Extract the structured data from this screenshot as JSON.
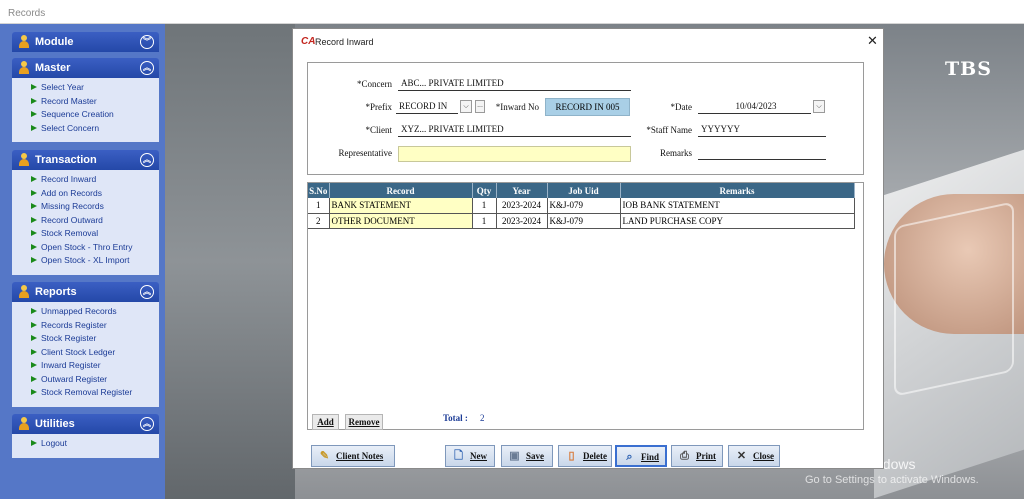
{
  "window": {
    "title": "Records"
  },
  "sidebar": {
    "module": {
      "title": "Module",
      "items": []
    },
    "master": {
      "title": "Master",
      "items": [
        "Select Year",
        "Record Master",
        "Sequence Creation",
        "Select Concern"
      ]
    },
    "transaction": {
      "title": "Transaction",
      "items": [
        "Record Inward",
        "Add on Records",
        "Missing Records",
        "Record Outward",
        "Stock Removal",
        "Open Stock - Thro Entry",
        "Open Stock - XL Import"
      ]
    },
    "reports": {
      "title": "Reports",
      "items": [
        "Unmapped Records",
        "Records Register",
        "Stock Register",
        "Client Stock Ledger",
        "Inward Register",
        "Outward Register",
        "Stock Removal Register"
      ]
    },
    "utilities": {
      "title": "Utilities",
      "items": [
        "Logout"
      ]
    }
  },
  "background": {
    "brand": "TBS",
    "activate_title": "Activate Windows",
    "activate_sub": "Go to Settings to activate Windows."
  },
  "dialog": {
    "title": "Record Inward",
    "close_glyph": "✕",
    "form": {
      "concern_label": "*Concern",
      "concern_value": "ABC... PRIVATE LIMITED",
      "prefix_label": "*Prefix",
      "prefix_value": "RECORD IN",
      "dots": "...",
      "inward_label": "*Inward No",
      "inward_value": "RECORD IN 005",
      "date_label": "*Date",
      "date_value": "10/04/2023",
      "client_label": "*Client",
      "client_value": "XYZ... PRIVATE LIMITED",
      "staff_label": "*Staff Name",
      "staff_value": "YYYYYY",
      "rep_label": "Representative",
      "rep_value": "",
      "remarks_label": "Remarks",
      "remarks_value": ""
    },
    "grid": {
      "columns": [
        "S.No",
        "Record",
        "Qty",
        "Year",
        "Job Uid",
        "Remarks"
      ],
      "rows": [
        [
          "1",
          "BANK STATEMENT",
          "1",
          "2023-2024",
          "K&J-079",
          "IOB BANK STATEMENT"
        ],
        [
          "2",
          "OTHER DOCUMENT",
          "1",
          "2023-2024",
          "K&J-079",
          "LAND PURCHASE COPY"
        ]
      ],
      "add_label": "Add",
      "remove_label": "Remove",
      "total_label": "Total :",
      "total_value": "2"
    },
    "buttons": {
      "client_notes": "Client Notes",
      "new": "New",
      "save": "Save",
      "delete": "Delete",
      "find": "Find",
      "print": "Print",
      "close": "Close"
    }
  }
}
